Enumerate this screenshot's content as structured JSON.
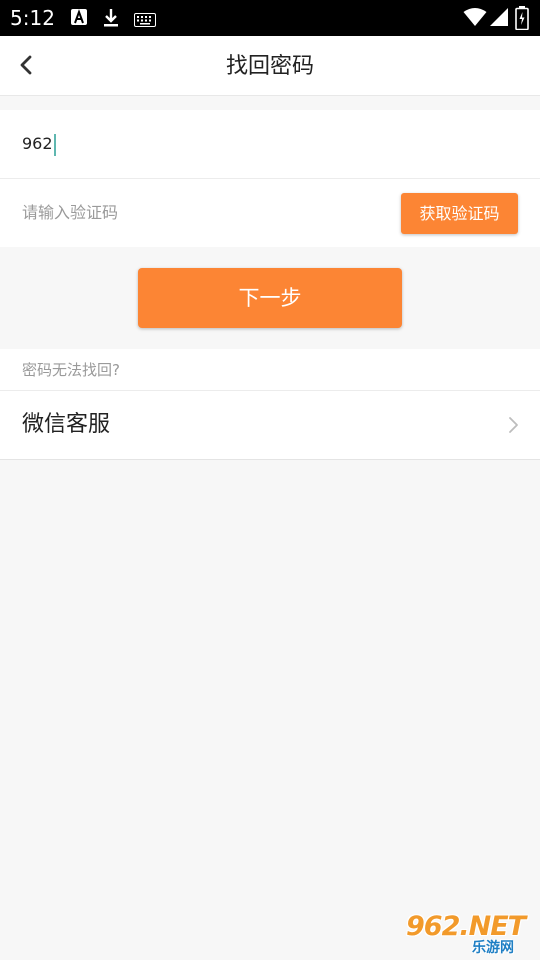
{
  "status_bar": {
    "time": "5:12",
    "icons": [
      "font-a-icon",
      "download-icon",
      "keyboard-icon",
      "wifi-icon",
      "signal-icon",
      "battery-icon"
    ]
  },
  "header": {
    "back_icon": "chevron-left-icon",
    "title": "找回密码"
  },
  "form": {
    "phone_value": "962",
    "code_placeholder": "请输入验证码",
    "get_code_label": "获取验证码"
  },
  "next_button": {
    "label": "下一步"
  },
  "help": {
    "title": "密码无法找回?",
    "wechat_label": "微信客服",
    "chevron_icon": "chevron-right-icon"
  },
  "watermark": {
    "main": "962.NET",
    "sub": "乐游网"
  },
  "colors": {
    "accent": "#fc8534",
    "status_bar_bg": "#000000",
    "page_bg": "#f7f7f7",
    "caret": "#5fb7b0"
  }
}
